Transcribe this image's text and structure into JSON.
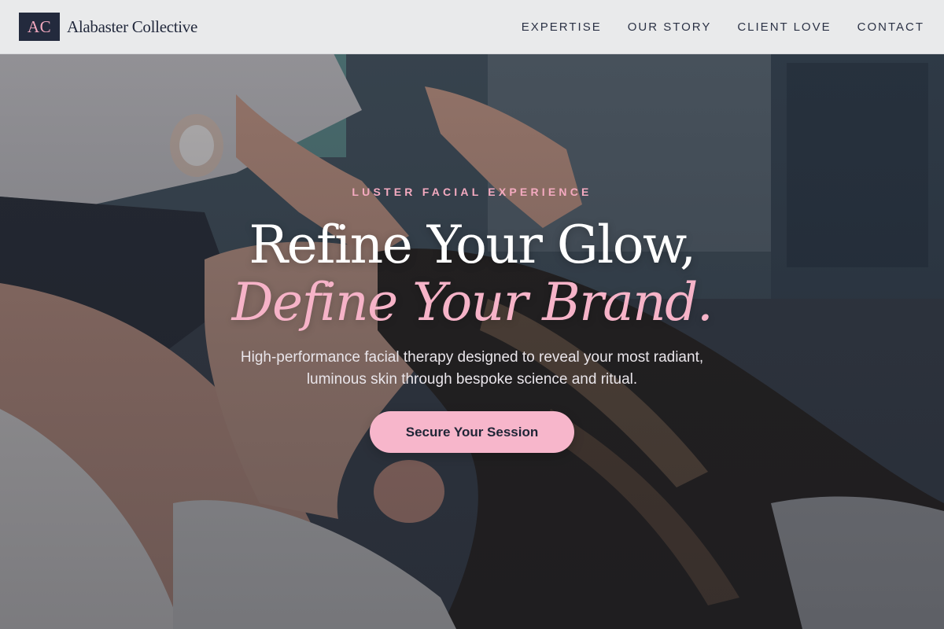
{
  "header": {
    "logo_mark": "AC",
    "brand_name": "Alabaster Collective",
    "nav": [
      "EXPERTISE",
      "OUR STORY",
      "CLIENT LOVE",
      "CONTACT"
    ]
  },
  "hero": {
    "eyebrow": "LUSTER FACIAL EXPERIENCE",
    "headline_line1": "Refine Your Glow,",
    "headline_line2": "Define Your Brand.",
    "subtext_line1": "High-performance facial therapy designed to reveal your most radiant,",
    "subtext_line2": "luminous skin through bespoke science and ritual.",
    "cta_label": "Secure Your Session",
    "background_image": "facial-treatment-photo"
  },
  "colors": {
    "accent_pink": "#f7b6cb",
    "navy": "#232a3d",
    "header_bg": "#e9eaeb"
  }
}
